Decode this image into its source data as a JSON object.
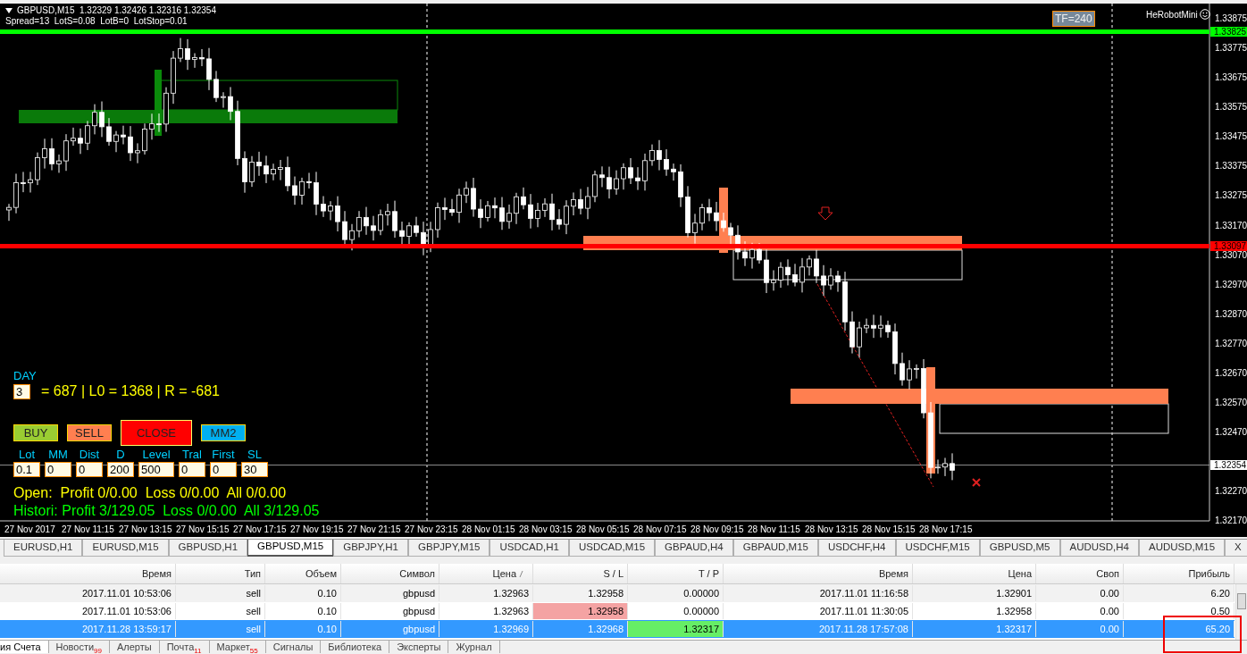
{
  "chart": {
    "title": "GBPUSD,M15  1.32329 1.32426 1.32316 1.32354",
    "info": "Spread=13  LotS=0.08  LotB=0  LotStop=0.01",
    "tf_badge": "TF=240",
    "robot": "HeRobotMini",
    "price_ticks": [
      "1.33875",
      "1.33775",
      "1.33675",
      "1.33575",
      "1.33475",
      "1.33375",
      "1.33275",
      "1.33170",
      "1.33070",
      "1.32970",
      "1.32870",
      "1.32770",
      "1.32670",
      "1.32570",
      "1.32470",
      "1.32270",
      "1.32170"
    ],
    "level_lines": [
      {
        "label": "1.33825",
        "color": "#00ff00"
      },
      {
        "label": "1.33097",
        "color": "#ff0000"
      }
    ],
    "current_price": "1.32354",
    "time_labels": [
      "27 Nov 2017",
      "27 Nov 11:15",
      "27 Nov 13:15",
      "27 Nov 15:15",
      "27 Nov 17:15",
      "27 Nov 19:15",
      "27 Nov 21:15",
      "27 Nov 23:15",
      "28 Nov 01:15",
      "28 Nov 03:15",
      "28 Nov 05:15",
      "28 Nov 07:15",
      "28 Nov 09:15",
      "28 Nov 11:15",
      "28 Nov 13:15",
      "28 Nov 15:15",
      "28 Nov 17:15"
    ]
  },
  "panel": {
    "period_label": "DAY",
    "period_value": "3",
    "summary": "= 687 | L0 = 1368 | R = -681",
    "buttons": [
      {
        "label": "BUY",
        "color": "#9acd32"
      },
      {
        "label": "SELL",
        "color": "#ff7f50"
      },
      {
        "label": "CLOSE",
        "color": "#ff0000"
      },
      {
        "label": "MM2",
        "color": "#00b0f0"
      }
    ],
    "params": [
      {
        "label": "Lot",
        "value": "0.1"
      },
      {
        "label": "MM",
        "value": "0"
      },
      {
        "label": "Dist",
        "value": "0"
      },
      {
        "label": "D",
        "value": "200"
      },
      {
        "label": "Level",
        "value": "500"
      },
      {
        "label": "Tral",
        "value": "0"
      },
      {
        "label": "First",
        "value": "0"
      },
      {
        "label": "SL",
        "value": "30"
      }
    ],
    "open_stats": "Open:  Profit 0/0.00  Loss 0/0.00  All 0/0.00",
    "history_stats": "Histori: Profit 3/129.05  Loss 0/0.00  All 3/129.05"
  },
  "symbol_tabs": [
    {
      "label": "EURUSD,H1",
      "selected": false
    },
    {
      "label": "EURUSD,M15",
      "selected": false
    },
    {
      "label": "GBPUSD,H1",
      "selected": false
    },
    {
      "label": "GBPUSD,M15",
      "selected": true
    },
    {
      "label": "GBPJPY,H1",
      "selected": false
    },
    {
      "label": "GBPJPY,M15",
      "selected": false
    },
    {
      "label": "USDCAD,H1",
      "selected": false
    },
    {
      "label": "USDCAD,M15",
      "selected": false
    },
    {
      "label": "GBPAUD,H4",
      "selected": false
    },
    {
      "label": "GBPAUD,M15",
      "selected": false
    },
    {
      "label": "USDCHF,H4",
      "selected": false
    },
    {
      "label": "USDCHF,M15",
      "selected": false
    },
    {
      "label": "GBPUSD,M5",
      "selected": false
    },
    {
      "label": "AUDUSD,H4",
      "selected": false
    },
    {
      "label": "AUDUSD,M15",
      "selected": false
    },
    {
      "label": "X",
      "selected": false
    }
  ],
  "terminal": {
    "columns": [
      {
        "label": "Время",
        "sorted": false
      },
      {
        "label": "Тип",
        "sorted": false
      },
      {
        "label": "Объем",
        "sorted": false
      },
      {
        "label": "Символ",
        "sorted": false
      },
      {
        "label": "Цена",
        "sorted": true
      },
      {
        "label": "S / L",
        "sorted": false
      },
      {
        "label": "T / P",
        "sorted": false
      },
      {
        "label": "Время",
        "sorted": false
      },
      {
        "label": "Цена",
        "sorted": false
      },
      {
        "label": "Своп",
        "sorted": false
      },
      {
        "label": "Прибыль",
        "sorted": false
      }
    ],
    "rows": [
      {
        "cells": [
          "2017.11.01 10:53:06",
          "sell",
          "0.10",
          "gbpusd",
          "1.32963",
          "1.32958",
          "0.00000",
          "2017.11.01 11:16:58",
          "1.32901",
          "0.00",
          "6.20"
        ],
        "selected": false,
        "sl_marked": false,
        "tp_marked": false
      },
      {
        "cells": [
          "2017.11.01 10:53:06",
          "sell",
          "0.10",
          "gbpusd",
          "1.32963",
          "1.32958",
          "0.00000",
          "2017.11.01 11:30:05",
          "1.32958",
          "0.00",
          "0.50"
        ],
        "selected": false,
        "sl_marked": true,
        "tp_marked": false
      },
      {
        "cells": [
          "2017.11.28 13:59:17",
          "sell",
          "0.10",
          "gbpusd",
          "1.32969",
          "1.32968",
          "1.32317",
          "2017.11.28 17:57:08",
          "1.32317",
          "0.00",
          "65.20"
        ],
        "selected": true,
        "sl_marked": false,
        "tp_marked": true
      }
    ],
    "tabs": [
      {
        "label": "ия Счета",
        "selected": true
      },
      {
        "label": "Новости",
        "badge": "99",
        "selected": false
      },
      {
        "label": "Алерты",
        "selected": false
      },
      {
        "label": "Почта",
        "badge": "11",
        "selected": false
      },
      {
        "label": "Маркет",
        "badge": "55",
        "selected": false
      },
      {
        "label": "Сигналы",
        "selected": false
      },
      {
        "label": "Библиотека",
        "selected": false
      },
      {
        "label": "Эксперты",
        "selected": false
      },
      {
        "label": "Журнал",
        "selected": false
      }
    ]
  }
}
